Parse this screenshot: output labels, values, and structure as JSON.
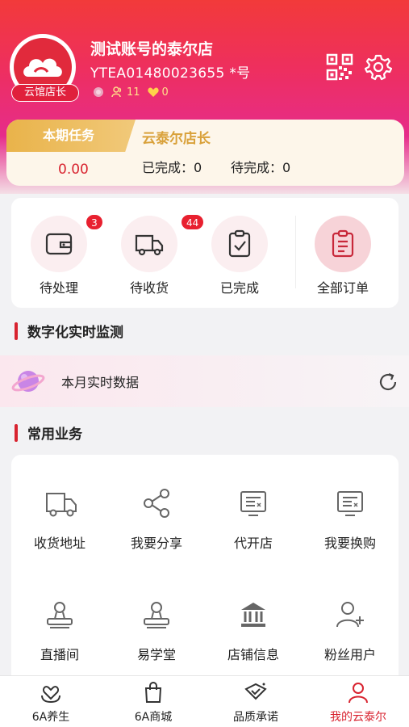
{
  "header": {
    "shop_name": "测试账号的泰尔店",
    "account_id": "YTEA01480023655 *号",
    "role_badge": "云馆店长",
    "stat_followers": "11",
    "stat_likes": "0",
    "qr_icon": "qr-code-icon",
    "settings_icon": "gear-icon"
  },
  "task": {
    "tab_label": "本期任务",
    "amount": "0.00",
    "role": "云泰尔店长",
    "done_label": "已完成：0",
    "pending_label": "待完成：0"
  },
  "orders": {
    "items": [
      {
        "label": "待处理",
        "badge": "3",
        "icon": "wallet-icon"
      },
      {
        "label": "待收货",
        "badge": "44",
        "icon": "truck-icon"
      },
      {
        "label": "已完成",
        "badge": "",
        "icon": "clipboard-check-icon"
      },
      {
        "label": "全部订单",
        "badge": "",
        "icon": "clipboard-list-icon"
      }
    ]
  },
  "monitor": {
    "section_title": "数字化实时监测",
    "row_label": "本月实时数据"
  },
  "services": {
    "section_title": "常用业务",
    "items": [
      {
        "label": "收货地址",
        "icon": "truck-icon"
      },
      {
        "label": "我要分享",
        "icon": "share-icon"
      },
      {
        "label": "代开店",
        "icon": "monitor-icon"
      },
      {
        "label": "我要换购",
        "icon": "monitor-icon"
      },
      {
        "label": "直播间",
        "icon": "stamp-icon"
      },
      {
        "label": "易学堂",
        "icon": "stamp-icon"
      },
      {
        "label": "店铺信息",
        "icon": "bank-icon"
      },
      {
        "label": "粉丝用户",
        "icon": "add-user-icon"
      }
    ]
  },
  "tabbar": {
    "items": [
      {
        "label": "6A养生",
        "icon": "heart-hand-icon"
      },
      {
        "label": "6A商城",
        "icon": "shopping-bag-icon"
      },
      {
        "label": "品质承诺",
        "icon": "badge-check-icon"
      },
      {
        "label": "我的云泰尔",
        "icon": "user-icon"
      }
    ],
    "active": 3
  },
  "colors": {
    "accent": "#d8232f",
    "gold": "#e9b34a"
  }
}
